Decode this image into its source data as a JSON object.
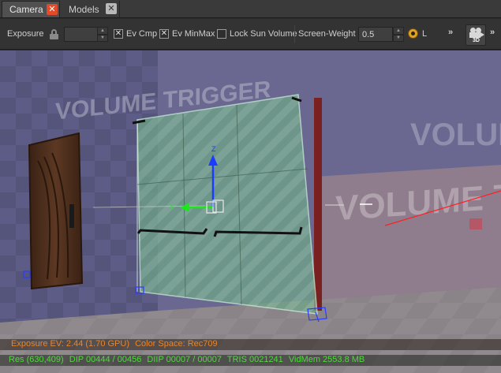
{
  "tabs": [
    {
      "label": "Camera",
      "active": true
    },
    {
      "label": "Models",
      "active": false
    }
  ],
  "toolbar": {
    "exposure_label": "Exposure",
    "exposure_value": "",
    "ev_cmp_label": "Ev Cmp",
    "ev_cmp_checked": true,
    "ev_minmax_label": "Ev MinMax",
    "ev_minmax_checked": true,
    "lock_sun_label": "Lock Sun Volume",
    "lock_sun_checked": false,
    "screen_weight_label": "Screen-Weight",
    "screen_weight_value": "0.5",
    "l_label": "L",
    "overflow_glyph": "»",
    "camera_mode_label": "3D",
    "accent_color": "#e0a020"
  },
  "viewport": {
    "wall_text": "VOLUME TRIGGER",
    "gizmo_axes": [
      "Z",
      "Y"
    ],
    "colors": {
      "axis_z": "#1a3cff",
      "axis_y": "#1ee61e",
      "axis_x": "#ff2020",
      "volume_fill": "#5fd08a"
    }
  },
  "status": {
    "exposure_ev": "Exposure EV: 2.44 (1.70 GPU)",
    "color_space": "Color Space: Rec709",
    "res": "Res (630,409)",
    "dip": "DIP 00444 / 00456",
    "diip": "DIIP 00007 / 00007",
    "tris": "TRIS 0021241",
    "vidmem": "VidMem 2553.8 MB",
    "ev_color": "#e8862a",
    "stats_color": "#4ddb3a"
  }
}
